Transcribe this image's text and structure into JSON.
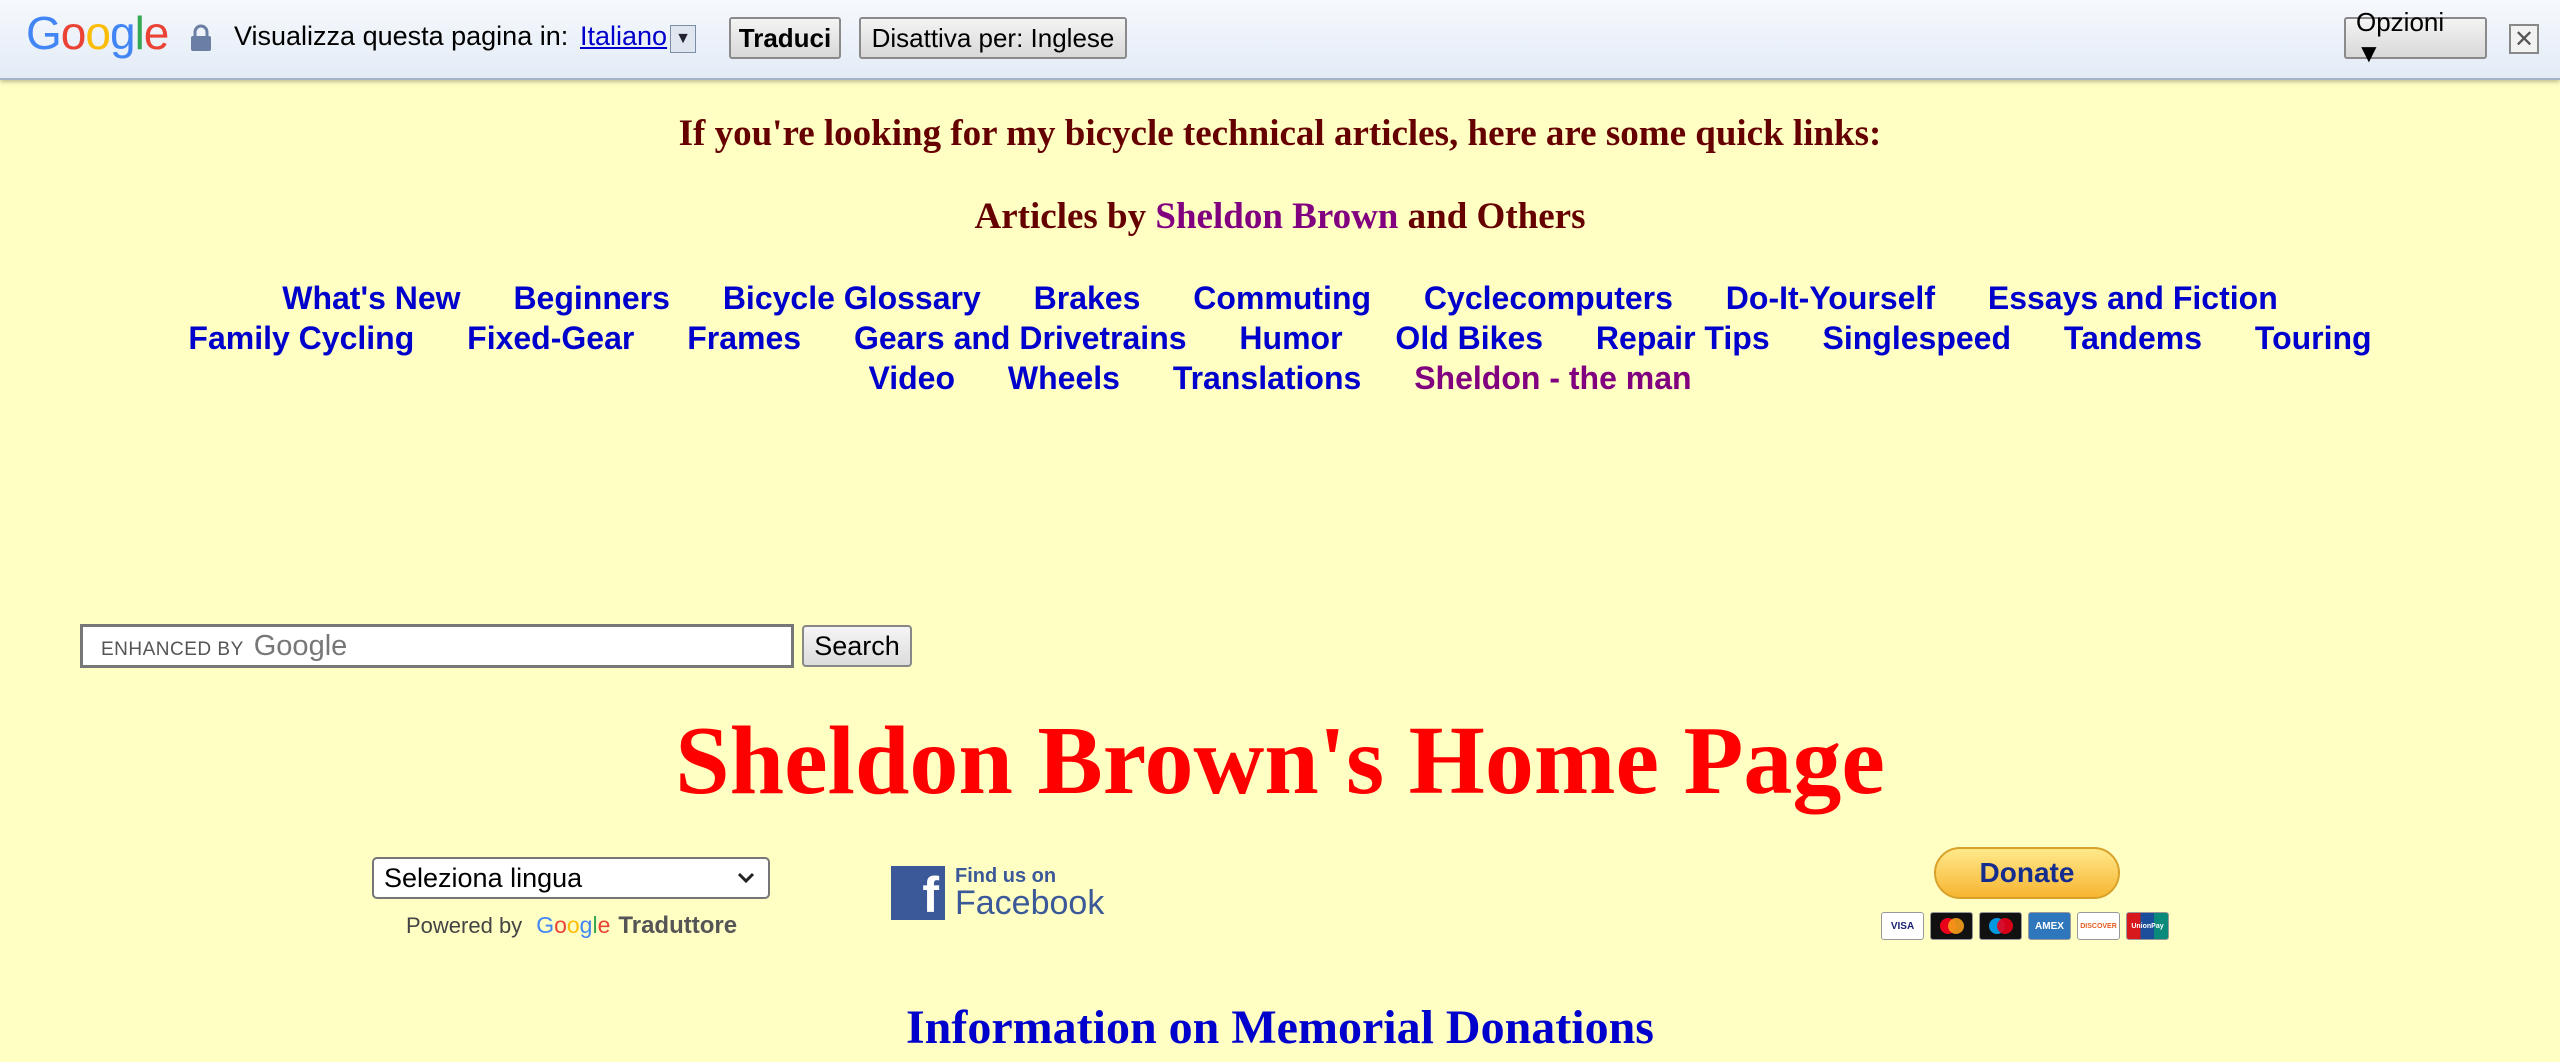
{
  "translate_bar": {
    "logo_letters": [
      "G",
      "o",
      "o",
      "g",
      "l",
      "e"
    ],
    "prompt": "Visualizza questa pagina in:",
    "language": "Italiano",
    "translate_button": "Traduci",
    "disable_button": "Disattiva per: Inglese",
    "options_button": "Opzioni ▼",
    "close_glyph": "✕",
    "dropdown_glyph": "▼"
  },
  "content": {
    "quick_links_heading": "If you're looking for my bicycle technical articles, here are some quick links:",
    "articles_heading": {
      "prefix": "Articles by ",
      "author": "Sheldon Brown",
      "suffix": " and Others"
    },
    "nav_links": [
      "What's New",
      "Beginners",
      "Bicycle Glossary",
      "Brakes",
      "Commuting",
      "Cyclecomputers",
      "Do-It-Yourself",
      "Essays and Fiction",
      "Family Cycling",
      "Fixed-Gear",
      "Frames",
      "Gears and Drivetrains",
      "Humor",
      "Old Bikes",
      "Repair Tips",
      "Singlespeed",
      "Tandems",
      "Touring",
      "Video",
      "Wheels",
      "Translations",
      "Sheldon - the man"
    ],
    "search": {
      "watermark_prefix": "ENHANCED BY",
      "watermark_brand": "Google",
      "button": "Search"
    },
    "page_title": "Sheldon Brown's Home Page",
    "language_select": {
      "selected": "Seleziona lingua",
      "powered_by": "Powered by",
      "brand_letters": [
        "G",
        "o",
        "o",
        "g",
        "l",
        "e"
      ],
      "translator": "Traduttore"
    },
    "facebook": {
      "find_us": "Find us on",
      "name": "Facebook",
      "glyph": "f"
    },
    "donate": {
      "button": "Donate",
      "cards": [
        "VISA",
        "MC",
        "Maestro",
        "AMEX",
        "DISCOVER",
        "UnionPay"
      ]
    },
    "memorial_link": "Information on Memorial Donations"
  },
  "colors": {
    "page_background": "#ffffc4",
    "heading": "#660000",
    "link": "#0000cc",
    "visited_link": "#800080",
    "title": "#ff0000"
  }
}
